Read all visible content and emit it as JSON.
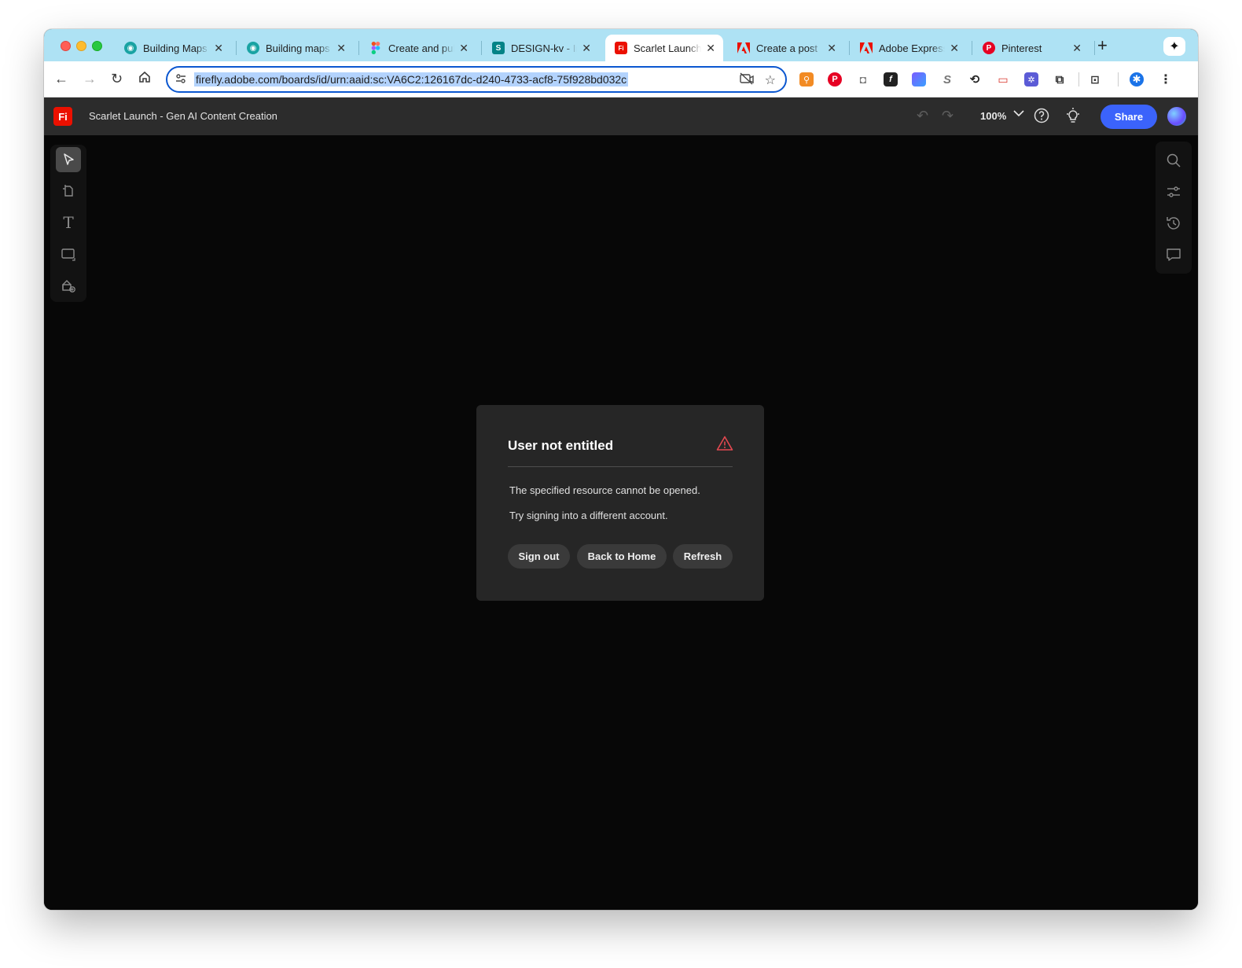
{
  "browser": {
    "tabs": [
      {
        "title": "Building Maps",
        "favicon_color": "#19a3a3"
      },
      {
        "title": "Building maps",
        "favicon_color": "#19a3a3"
      },
      {
        "title": "Create and pub",
        "favicon_color": "#a259ff"
      },
      {
        "title": "DESIGN-kv - In",
        "favicon_color": "#038387"
      },
      {
        "title": "Scarlet Launch",
        "favicon_color": "#eb1000",
        "active": true
      },
      {
        "title": "Create a post",
        "favicon_color": "#eb1000"
      },
      {
        "title": "Adobe Express",
        "favicon_color": "#eb1000"
      },
      {
        "title": "Pinterest",
        "favicon_color": "#e60023"
      }
    ],
    "url": "firefly.adobe.com/boards/id/urn:aaid:sc:VA6C2:126167dc-d240-4733-acf8-75f928bd032c"
  },
  "app": {
    "logo_text": "Fi",
    "title": "Scarlet Launch - Gen AI Content Creation",
    "zoom": "100%",
    "share_label": "Share"
  },
  "dialog": {
    "title": "User not entitled",
    "line1": "The specified resource cannot be opened.",
    "line2": "Try signing into a different account.",
    "buttons": {
      "sign_out": "Sign out",
      "back_home": "Back to Home",
      "refresh": "Refresh"
    }
  },
  "colors": {
    "tab_bar": "#aee2f4",
    "accent_blue": "#3b63fb",
    "warning_red": "#e34850",
    "firefly_red": "#eb1000"
  }
}
